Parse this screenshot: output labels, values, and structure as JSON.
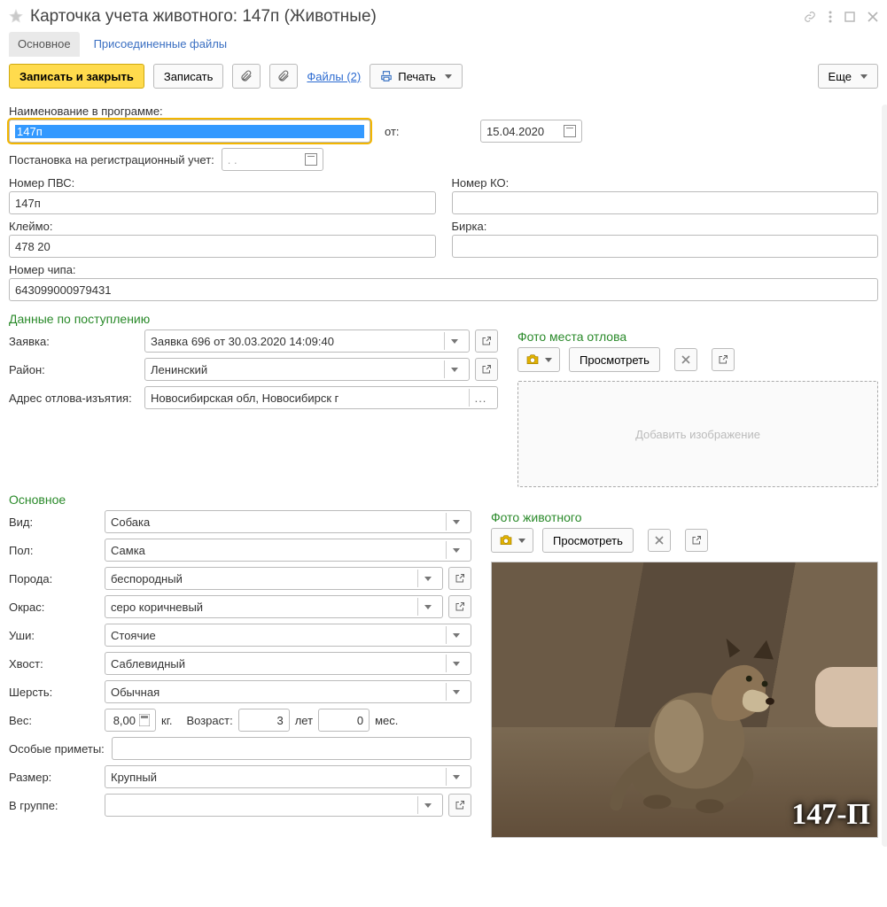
{
  "window": {
    "title": "Карточка учета животного: 147п (Животные)"
  },
  "tabs": {
    "main": "Основное",
    "files": "Присоединенные файлы"
  },
  "toolbar": {
    "save_close": "Записать и закрыть",
    "save": "Записать",
    "files_link": "Файлы (2)",
    "print": "Печать",
    "more": "Еще"
  },
  "labels": {
    "name_in_prog": "Наименование в программе:",
    "ot": "от:",
    "reg": "Постановка на регистрационный учет:",
    "pvs": "Номер ПВС:",
    "ko": "Номер КО:",
    "kleymo": "Клеймо:",
    "birka": "Бирка:",
    "chip": "Номер чипа:",
    "section_intake": "Данные по поступлению",
    "zayavka": "Заявка:",
    "raion": "Район:",
    "address": "Адрес отлова-изъятия:",
    "photo_catch": "Фото места отлова",
    "view_btn": "Просмотреть",
    "add_image": "Добавить изображение",
    "section_main": "Основное",
    "vid": "Вид:",
    "pol": "Пол:",
    "poroda": "Порода:",
    "okras": "Окрас:",
    "ushi": "Уши:",
    "hvost": "Хвост:",
    "sherst": "Шерсть:",
    "ves": "Вес:",
    "kg": "кг.",
    "vozrast": "Возраст:",
    "let": "лет",
    "mes": "мес.",
    "osob": "Особые приметы:",
    "razmer": "Размер:",
    "vgruppe": "В группе:",
    "photo_animal": "Фото животного"
  },
  "vals": {
    "name": "147п",
    "date": "15.04.2020",
    "reg_date": "  .  .    ",
    "pvs": "147п",
    "ko": "",
    "kleymo": "478 20",
    "birka": "",
    "chip": "643099000979431",
    "zayavka": "Заявка 696 от 30.03.2020 14:09:40",
    "raion": "Ленинский",
    "address": "Новосибирская обл, Новосибирск г",
    "vid": "Собака",
    "pol": "Самка",
    "poroda": "беспородный",
    "okras": "серо коричневый",
    "ushi": "Стоячие",
    "hvost": "Саблевидный",
    "sherst": "Обычная",
    "ves": "8,00",
    "age_y": "3",
    "age_m": "0",
    "osob": "",
    "razmer": "Крупный",
    "vgruppe": "",
    "photo_tag": "147-П"
  }
}
